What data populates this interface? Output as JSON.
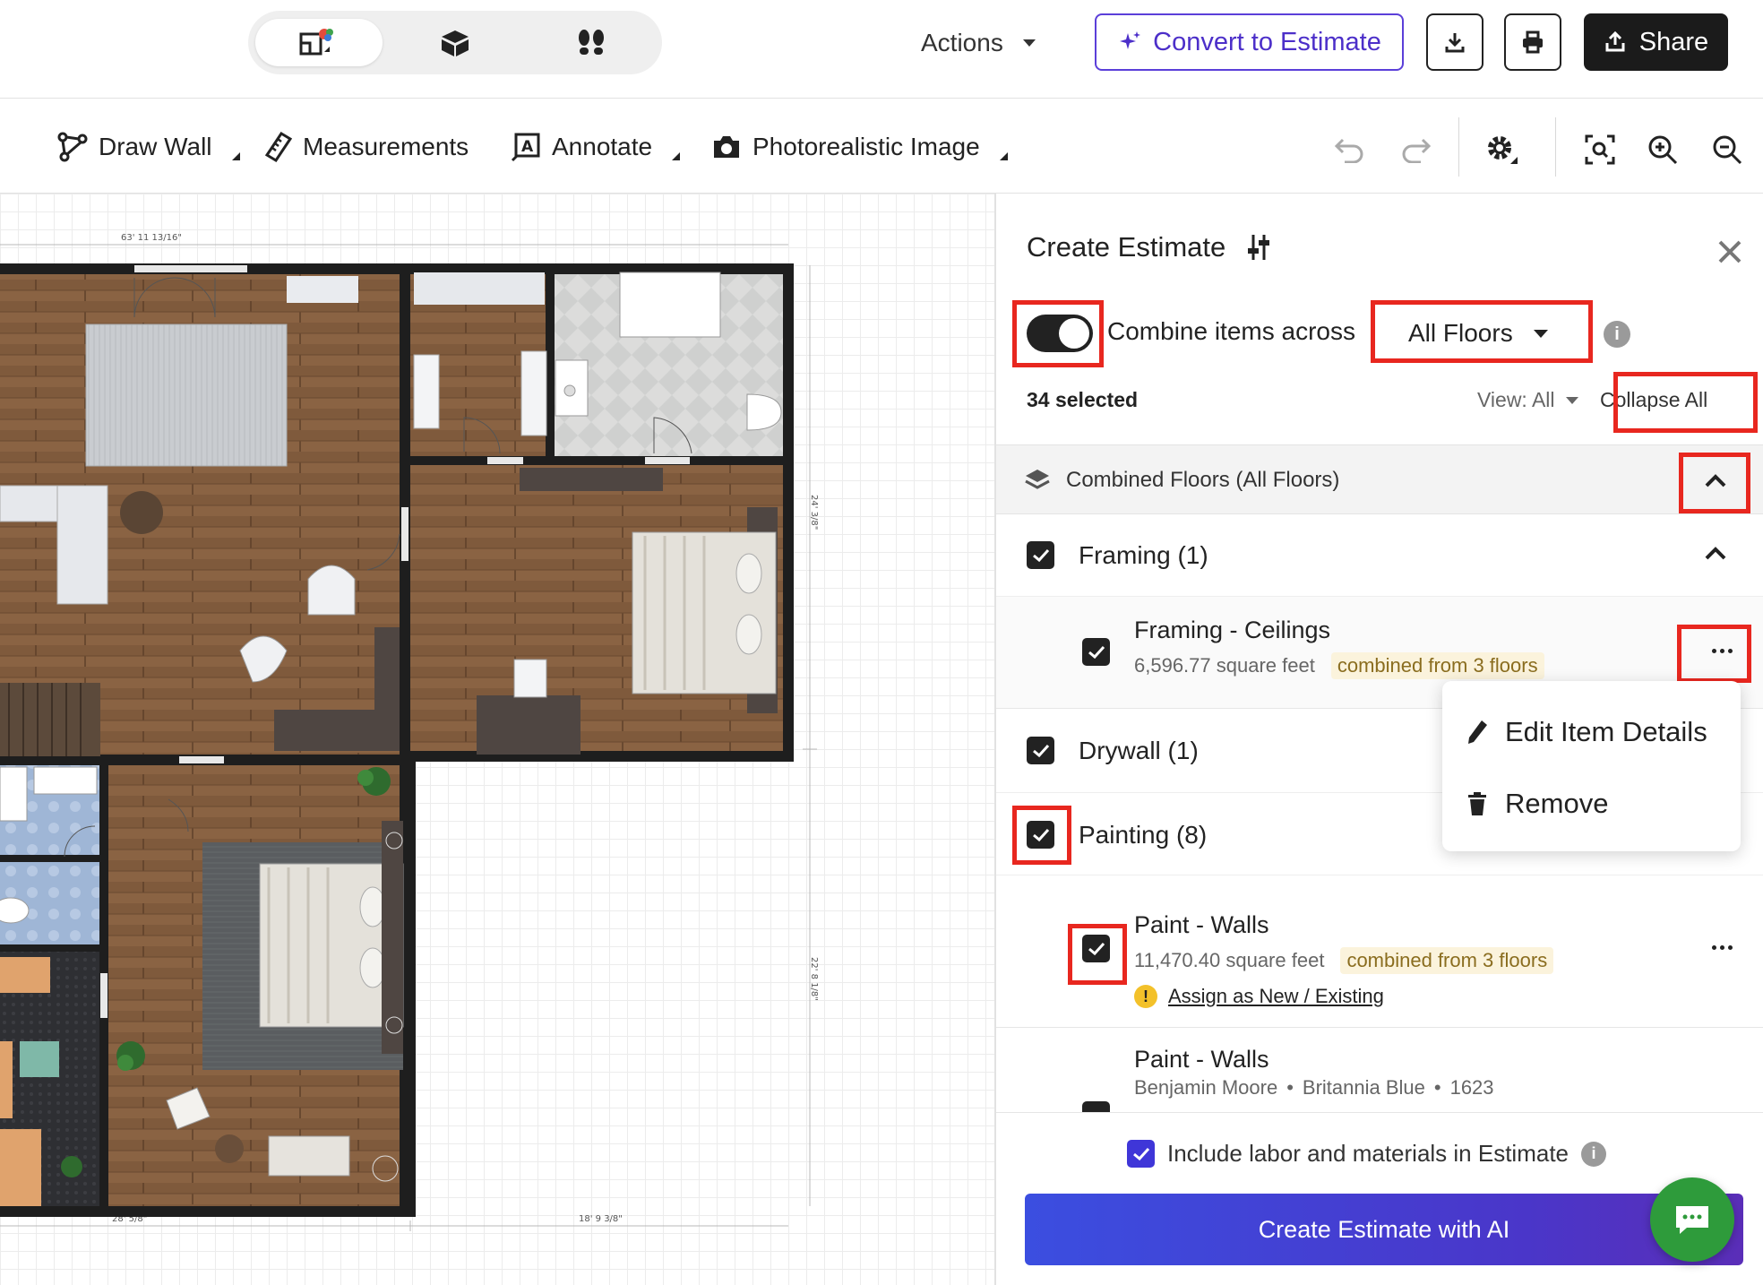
{
  "topbar": {
    "view_switch": [
      "floorplan-2d-icon",
      "floorplan-3d-icon",
      "walkthrough-icon"
    ],
    "actions_label": "Actions",
    "convert_label": "Convert to Estimate",
    "share_label": "Share"
  },
  "toolbar": {
    "draw_wall": "Draw Wall",
    "measurements": "Measurements",
    "annotate": "Annotate",
    "photo_image": "Photorealistic Image"
  },
  "canvas": {
    "dim_top": "63' 11 13/16\"",
    "dim_right_upper": "24' 3/8\"",
    "dim_right_lower": "22' 8 1/8\"",
    "dim_bottom_left": "28' 5/8\"",
    "dim_bottom_right": "18' 9 3/8\""
  },
  "panel": {
    "title": "Create Estimate",
    "combine_label": "Combine items across",
    "floors_value": "All Floors",
    "selected_count": "34 selected",
    "view_label": "View: All",
    "collapse_all": "Collapse All",
    "group_label": "Combined Floors (All Floors)",
    "framing": {
      "category": "Framing (1)",
      "item_title": "Framing - Ceilings",
      "item_qty": "6,596.77 square feet",
      "item_badge": "combined from 3 floors"
    },
    "drywall": {
      "category": "Drywall (1)"
    },
    "painting": {
      "category": "Painting (8)",
      "item1_title": "Paint - Walls",
      "item1_qty": "11,470.40 square feet",
      "item1_badge": "combined from 3 floors",
      "item1_link": "Assign as New / Existing",
      "item2_title": "Paint - Walls",
      "item2_brand": "Benjamin Moore",
      "item2_color": "Britannia Blue",
      "item2_code": "1623"
    },
    "menu": {
      "edit": "Edit Item Details",
      "remove": "Remove"
    },
    "include_label": "Include labor and materials in Estimate",
    "cta_label": "Create Estimate with AI"
  },
  "colors": {
    "accent": "#4c2fc9",
    "highlight": "#e8271f",
    "chat": "#2e9b3b",
    "dark": "#1b1b1b"
  }
}
